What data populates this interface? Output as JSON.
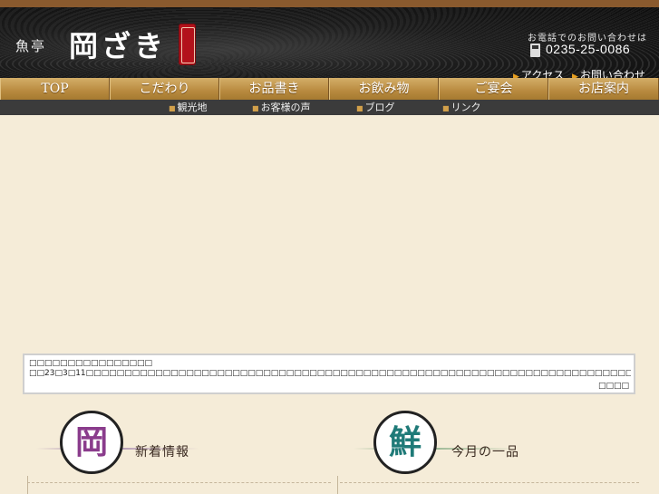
{
  "header": {
    "brand_small": "魚亭",
    "brand_big": "岡ざき",
    "tel_caption": "お電話でのお問い合わせは",
    "tel_number": "0235-25-0086",
    "links": [
      {
        "label": "アクセス"
      },
      {
        "label": "お問い合わせ"
      }
    ]
  },
  "global_nav": [
    {
      "label": "TOP"
    },
    {
      "label": "こだわり"
    },
    {
      "label": "お品書き"
    },
    {
      "label": "お飲み物"
    },
    {
      "label": "ご宴会"
    },
    {
      "label": "お店案内"
    }
  ],
  "sub_nav": [
    {
      "label": "観光地"
    },
    {
      "label": "お客様の声"
    },
    {
      "label": "ブログ"
    },
    {
      "label": "リンク"
    }
  ],
  "notice": {
    "title": "□□□□□□□□□□□□□□□□",
    "body": "□□23□3□11□□□□□□□□□□□□□□□□□□□□□□□□□□□□□□□□□□□□□□□□□□□□□□□□□□□□□□□□□□□□□□□□□□□□□□□□",
    "more": "□□□□"
  },
  "sections": [
    {
      "title": "新着情報",
      "emblem": "岡"
    },
    {
      "title": "今月の一品",
      "emblem": "鮮"
    }
  ],
  "colors": {
    "page_bg": "#f5ecd8",
    "nav_gold": "#b88a3f",
    "subnav_bg": "#3b3b3b",
    "accent_orange": "#e8a020",
    "emblem_purple": "#8a3c8c",
    "emblem_teal": "#1f7a78"
  }
}
